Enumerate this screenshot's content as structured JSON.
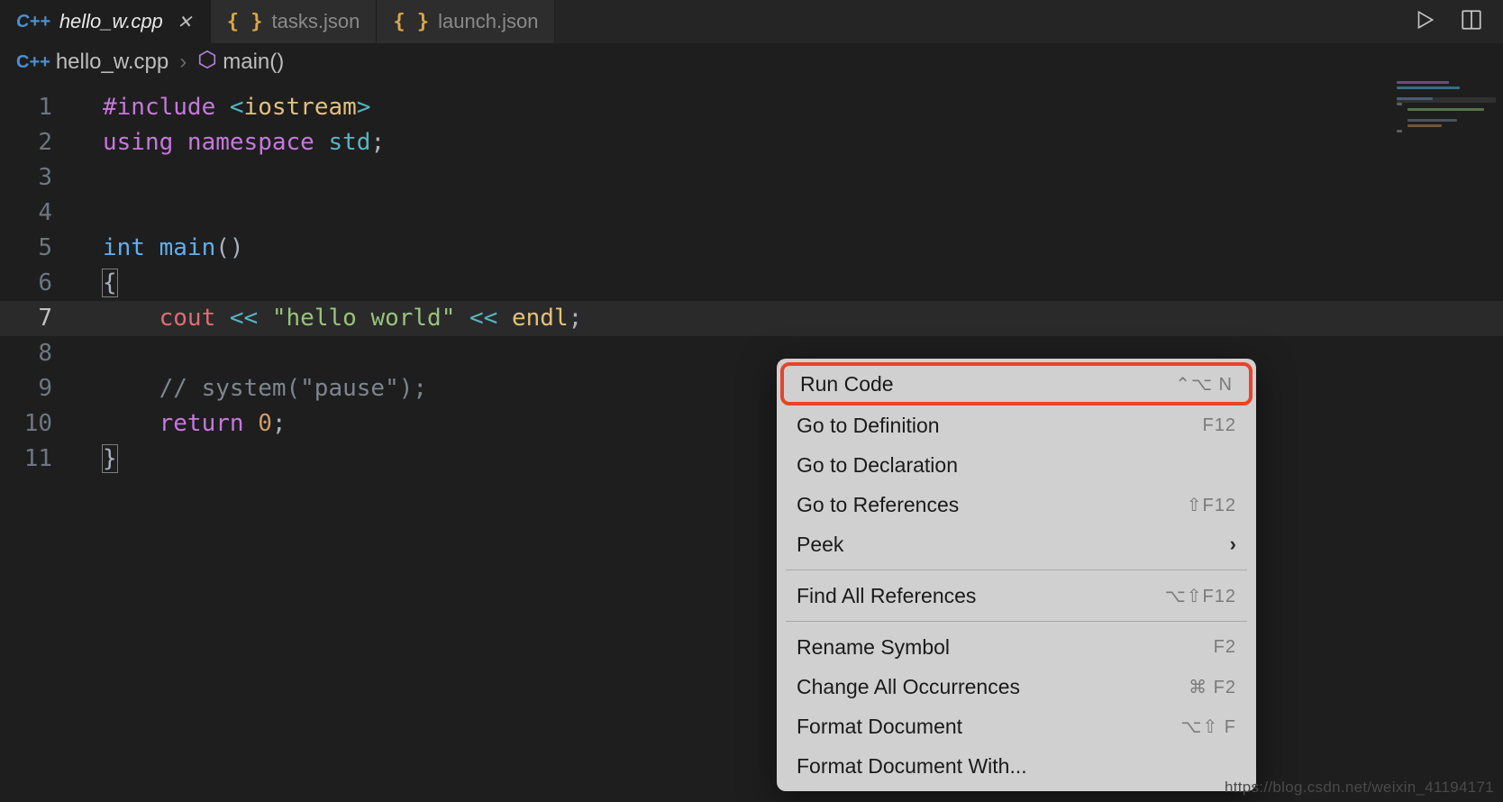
{
  "tabs": [
    {
      "label": "hello_w.cpp",
      "icon": "C++",
      "active": true,
      "closable": true
    },
    {
      "label": "tasks.json",
      "icon": "{ }",
      "active": false,
      "closable": false
    },
    {
      "label": "launch.json",
      "icon": "{ }",
      "active": false,
      "closable": false
    }
  ],
  "breadcrumb": {
    "file_icon": "C++",
    "file": "hello_w.cpp",
    "symbol": "main()"
  },
  "code": {
    "lines": [
      {
        "n": "1",
        "tokens": [
          [
            "pre",
            "#include "
          ],
          [
            "op",
            "<"
          ],
          [
            "id",
            "iostream"
          ],
          [
            "op",
            ">"
          ]
        ]
      },
      {
        "n": "2",
        "tokens": [
          [
            "kw",
            "using "
          ],
          [
            "kw",
            "namespace "
          ],
          [
            "ns",
            "std"
          ],
          [
            "punc",
            ";"
          ]
        ]
      },
      {
        "n": "3",
        "tokens": []
      },
      {
        "n": "4",
        "tokens": []
      },
      {
        "n": "5",
        "tokens": [
          [
            "type",
            "int "
          ],
          [
            "fn",
            "main"
          ],
          [
            "punc",
            "()"
          ]
        ]
      },
      {
        "n": "6",
        "tokens": [
          [
            "punc",
            "{"
          ]
        ],
        "boxed": true
      },
      {
        "n": "7",
        "tokens": [
          [
            "punc",
            "    "
          ],
          [
            "obj",
            "cout"
          ],
          [
            "punc",
            " "
          ],
          [
            "op",
            "<<"
          ],
          [
            "punc",
            " "
          ],
          [
            "str",
            "\"hello world\""
          ],
          [
            "punc",
            " "
          ],
          [
            "op",
            "<<"
          ],
          [
            "punc",
            " "
          ],
          [
            "id",
            "endl"
          ],
          [
            "punc",
            ";"
          ]
        ],
        "highlight": true
      },
      {
        "n": "8",
        "tokens": []
      },
      {
        "n": "9",
        "tokens": [
          [
            "punc",
            "    "
          ],
          [
            "cmt",
            "// system(\"pause\");"
          ]
        ]
      },
      {
        "n": "10",
        "tokens": [
          [
            "punc",
            "    "
          ],
          [
            "kw",
            "return "
          ],
          [
            "num",
            "0"
          ],
          [
            "punc",
            ";"
          ]
        ]
      },
      {
        "n": "11",
        "tokens": [
          [
            "punc",
            "}"
          ]
        ],
        "boxed": true
      }
    ]
  },
  "context_menu": {
    "groups": [
      [
        {
          "label": "Run Code",
          "shortcut": "⌃⌥ N",
          "highlighted": true
        },
        {
          "label": "Go to Definition",
          "shortcut": "F12"
        },
        {
          "label": "Go to Declaration",
          "shortcut": ""
        },
        {
          "label": "Go to References",
          "shortcut": "⇧F12"
        },
        {
          "label": "Peek",
          "submenu": true
        }
      ],
      [
        {
          "label": "Find All References",
          "shortcut": "⌥⇧F12"
        }
      ],
      [
        {
          "label": "Rename Symbol",
          "shortcut": "F2"
        },
        {
          "label": "Change All Occurrences",
          "shortcut": "⌘ F2"
        },
        {
          "label": "Format Document",
          "shortcut": "⌥⇧ F"
        },
        {
          "label": "Format Document With...",
          "shortcut": ""
        }
      ]
    ]
  },
  "watermark": "https://blog.csdn.net/weixin_41194171"
}
